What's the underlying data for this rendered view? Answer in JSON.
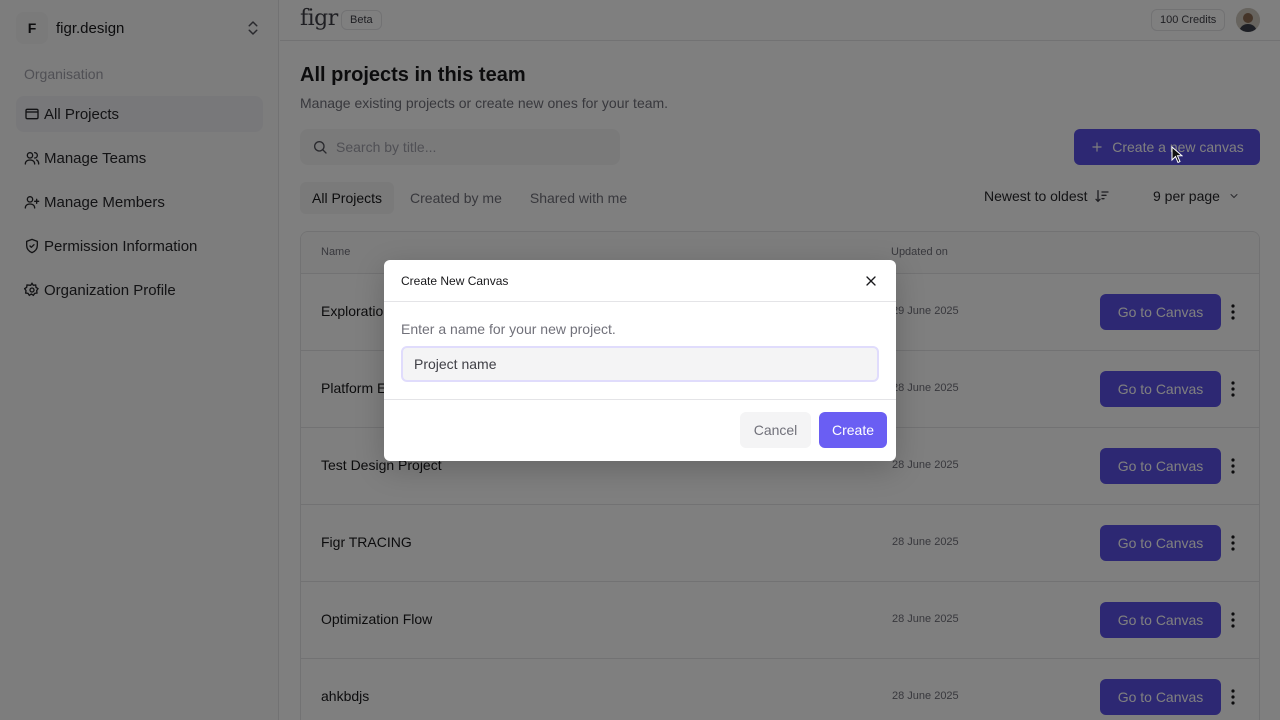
{
  "org": {
    "initial": "F",
    "name": "figr.design"
  },
  "sidebar": {
    "section_label": "Organisation",
    "items": [
      {
        "label": "All Projects",
        "icon": "folder-icon"
      },
      {
        "label": "Manage Teams",
        "icon": "users-icon"
      },
      {
        "label": "Manage Members",
        "icon": "user-plus-icon"
      },
      {
        "label": "Permission Information",
        "icon": "shield-check-icon"
      },
      {
        "label": "Organization Profile",
        "icon": "settings-icon"
      }
    ]
  },
  "topbar": {
    "logo": "figr",
    "badge": "Beta",
    "credits": "100 Credits"
  },
  "main": {
    "title": "All projects in this team",
    "subtitle": "Manage existing projects or create new ones for your team.",
    "search_placeholder": "Search by title...",
    "create_label": "Create a new canvas",
    "tabs": [
      "All Projects",
      "Created by me",
      "Shared with me"
    ],
    "sort_label": "Newest to oldest",
    "per_page_label": "9 per page",
    "table": {
      "col_name": "Name",
      "col_updated": "Updated on",
      "goto_label": "Go to Canvas",
      "rows": [
        {
          "name": "Exploratio",
          "date": "29 June 2025"
        },
        {
          "name": "Platform E",
          "date": "28 June 2025"
        },
        {
          "name": "Test Design Project",
          "date": "28 June 2025"
        },
        {
          "name": "Figr TRACING",
          "date": "28 June 2025"
        },
        {
          "name": "Optimization Flow",
          "date": "28 June 2025"
        },
        {
          "name": "ahkbdjs",
          "date": "28 June 2025"
        }
      ]
    }
  },
  "modal": {
    "title": "Create New Canvas",
    "label": "Enter a name for your new project.",
    "input_placeholder": "Project name",
    "cancel_label": "Cancel",
    "create_label": "Create"
  },
  "colors": {
    "primary": "#5b50e6",
    "overlay": "rgba(0,0,0,0.5)"
  }
}
